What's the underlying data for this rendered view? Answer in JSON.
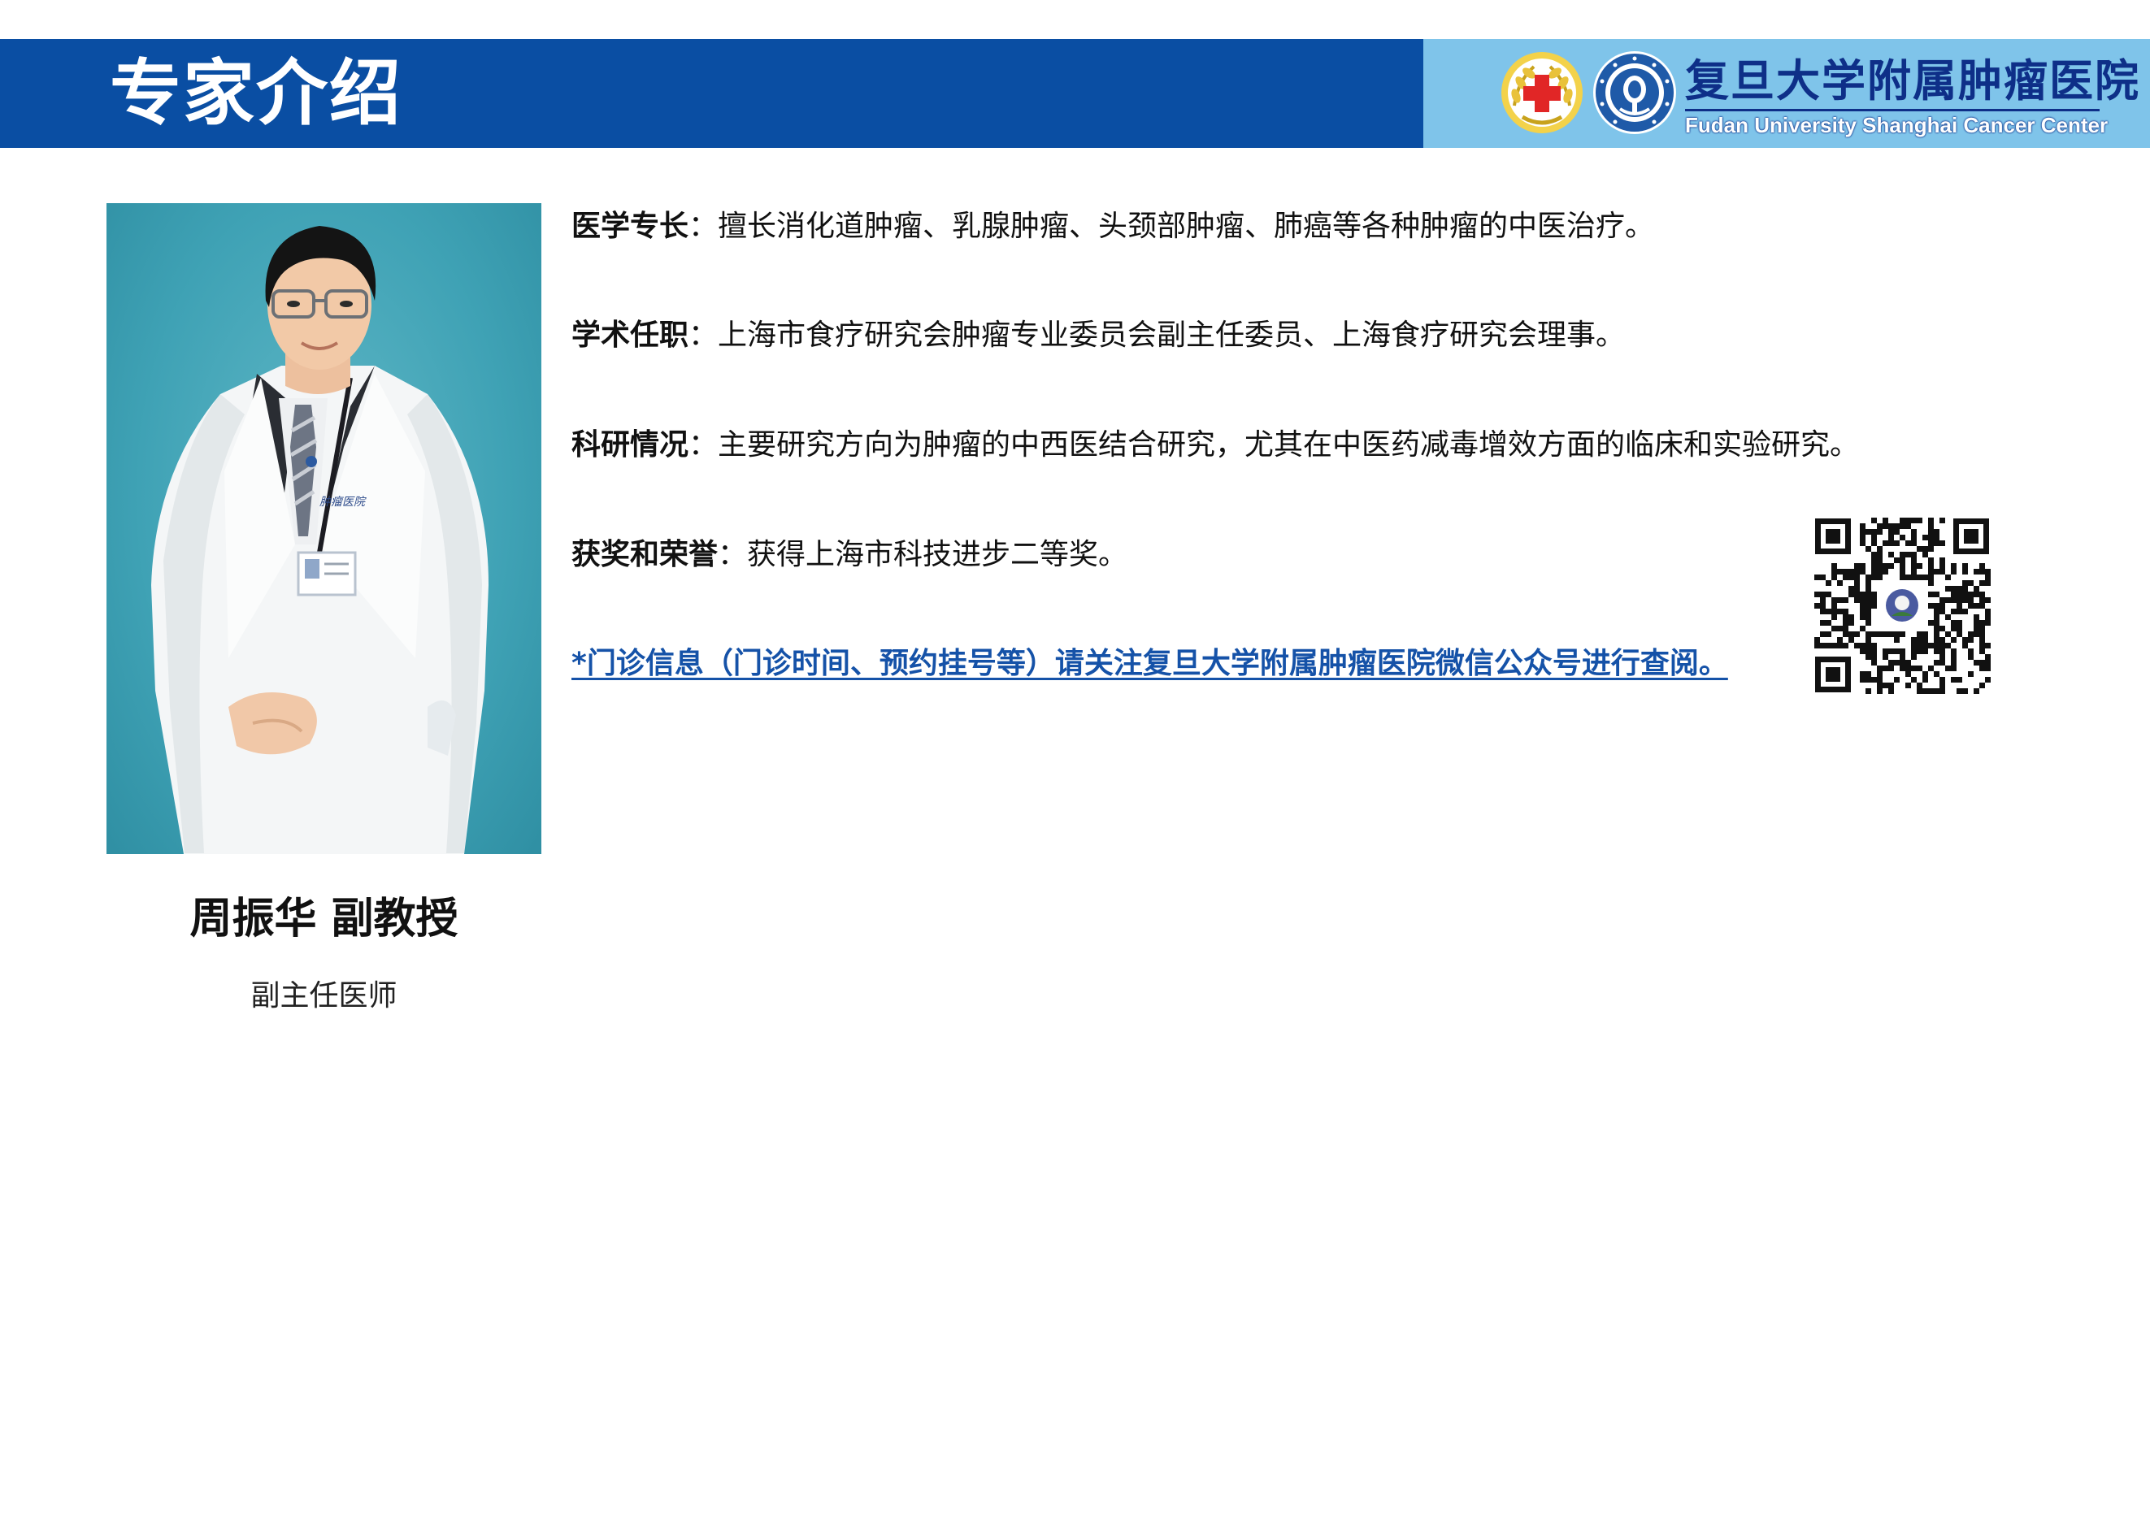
{
  "header": {
    "title": "专家介绍",
    "logo_cn": "复旦大学附属肿瘤医院",
    "logo_en": "Fudan University Shanghai Cancer Center",
    "colors": {
      "header_bar": "#0a4ea3",
      "logo_panel": "#7fc4ea",
      "logo_text": "#0e2f88"
    },
    "emblems": [
      "red-cross-emblem-icon",
      "hospital-seal-icon"
    ]
  },
  "doctor": {
    "photo": "doctor-portrait",
    "name": "周振华 副教授",
    "title": "副主任医师"
  },
  "details": [
    {
      "label": "医学专长",
      "sep": "：",
      "text": "擅长消化道肿瘤、乳腺肿瘤、头颈部肿瘤、肺癌等各种肿瘤的中医治疗。"
    },
    {
      "label": "学术任职",
      "sep": "：",
      "text": "上海市食疗研究会肿瘤专业委员会副主任委员、上海食疗研究会理事。"
    },
    {
      "label": "科研情况",
      "sep": "：",
      "text": "主要研究方向为肿瘤的中西医结合研究，尤其在中医药减毒增效方面的临床和实验研究。"
    },
    {
      "label": "获奖和荣誉",
      "sep": "：",
      "text": "获得上海市科技进步二等奖。"
    }
  ],
  "notice": {
    "text": "*门诊信息（门诊时间、预约挂号等）请关注复旦大学附属肿瘤医院微信公众号进行查阅。",
    "color": "#1552a8"
  },
  "qr": {
    "icon": "wechat-qr-code-icon"
  }
}
